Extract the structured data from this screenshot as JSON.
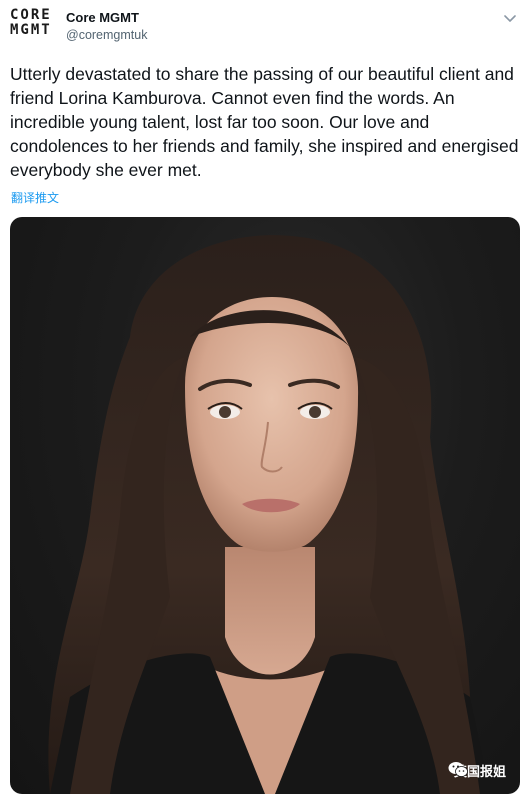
{
  "account": {
    "avatar_lines": [
      "CORE",
      "MGMT"
    ],
    "display_name": "Core MGMT",
    "handle": "@coremgmtuk"
  },
  "tweet": {
    "text": "Utterly devastated to share the passing of our beautiful client and friend Lorina Kamburova. Cannot even find the words. An incredible young talent, lost far too soon. Our love and condolences to her friends and family, she inspired and energised everybody she ever met.",
    "translate_label": "翻译推文"
  },
  "media": {
    "watermark": "英国报姐"
  },
  "colors": {
    "link": "#1d9bf0",
    "secondary_text": "#536471"
  },
  "icons": {
    "menu": "chevron-down-icon",
    "watermark": "wechat-icon"
  }
}
